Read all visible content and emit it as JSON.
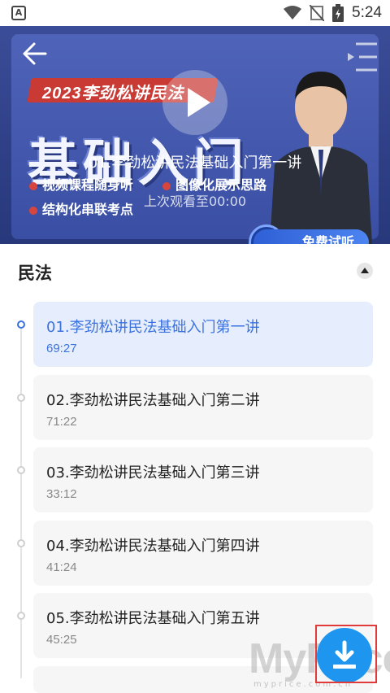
{
  "status_bar": {
    "time": "5:24",
    "left_icon_letter": "A"
  },
  "banner": {
    "tag_text": "2023李劲松讲民法",
    "big_title": "基础入门",
    "features": [
      "视频课程随身听",
      "图像化展示思路",
      "结构化串联考点"
    ],
    "free_trial": "免费试听",
    "video_title": "01.李劲松讲民法基础入门第一讲",
    "last_watched": "上次观看至00:00"
  },
  "section": {
    "title": "民法"
  },
  "lessons": [
    {
      "title": "01.李劲松讲民法基础入门第一讲",
      "duration": "69:27",
      "active": true
    },
    {
      "title": "02.李劲松讲民法基础入门第二讲",
      "duration": "71:22",
      "active": false
    },
    {
      "title": "03.李劲松讲民法基础入门第三讲",
      "duration": "33:12",
      "active": false
    },
    {
      "title": "04.李劲松讲民法基础入门第四讲",
      "duration": "41:24",
      "active": false
    },
    {
      "title": "05.李劲松讲民法基础入门第五讲",
      "duration": "45:25",
      "active": false
    }
  ],
  "watermark": {
    "main": "MyPrice",
    "sub": "myprice.com.cn"
  },
  "colors": {
    "accent": "#3b72e0",
    "fab": "#1e96f0",
    "banner": "#3b4d98",
    "highlight_box": "#e03a3a"
  }
}
